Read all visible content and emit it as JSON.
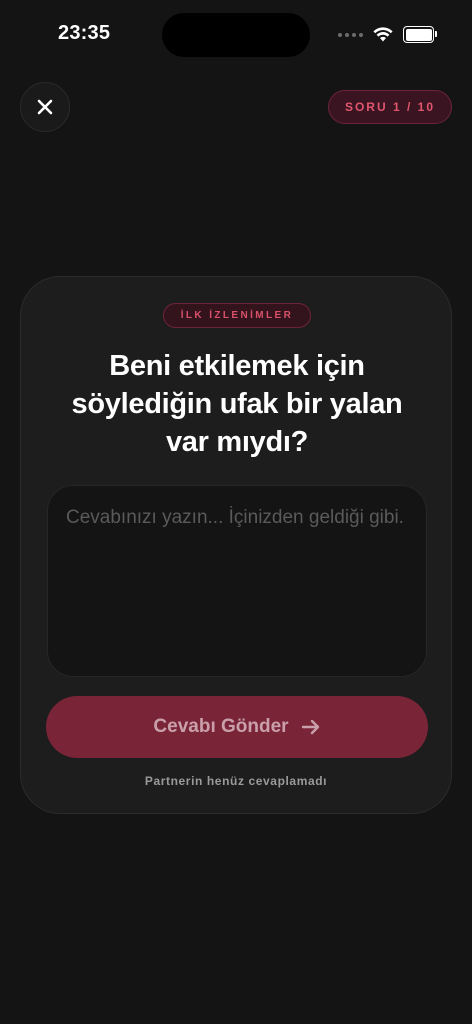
{
  "status_bar": {
    "time": "23:35"
  },
  "header": {
    "close_icon": "close-icon",
    "question_counter": "SORU 1 / 10"
  },
  "card": {
    "category": "İLK İZLENİMLER",
    "question": "Beni etkilemek için söylediğin ufak bir yalan var mıydı?",
    "answer": {
      "value": "",
      "placeholder": "Cevabınızı yazın... İçinizden geldiği gibi."
    },
    "submit_label": "Cevabı Gönder",
    "submit_icon": "arrow-right-icon",
    "partner_status": "Partnerin henüz cevaplamadı"
  },
  "colors": {
    "background": "#141414",
    "card": "#1d1d1d",
    "accent": "#7a2438",
    "accent_text": "#e0566f"
  }
}
